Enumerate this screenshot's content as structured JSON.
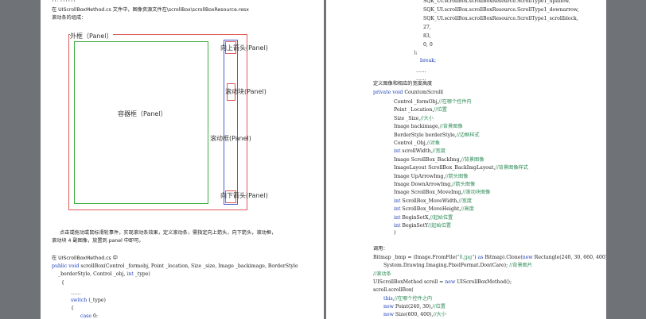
{
  "left_page": {
    "heading_fragment": "??. ??????",
    "intro_line": "在 UIScrollBoxMethod.cs 文件中，图像资源文件在\\scrollBox\\scrollBoxResource.resx",
    "intro_line2": "滚动条的组成：",
    "diagram": {
      "outer": "外框（Panel）",
      "up_arrow": "向上箭头(Panel)",
      "thumb": "滚动块(Panel)",
      "container": "容器框（Panel）",
      "track": "滚动框(Panel)",
      "down_arrow": "向下箭头(Panel)"
    },
    "paragraph1": "点击或拖动或鼠标滑轮事件，实现滚动条效果，定义滚动条，需指定向上箭头，向下箭头，滚动框，",
    "paragraph2": "滚动块 4 副图像，放置到 panel 中即可。",
    "code_intro": "在 UIScrollBoxMethod.cs 中",
    "code_lines": [
      {
        "kw": "public void",
        "text": " scrollBox(Control _formobj, Point _location, Size _size, Image _backimage, BorderStyle",
        "cm": ""
      },
      {
        "kw": "",
        "text": "_borderStyle, Control _obj, ",
        "kw2": "int",
        "text2": " _type)"
      },
      {
        "kw": "",
        "text": "{",
        "cm": ""
      },
      {
        "kw": "",
        "text": "……",
        "cm": ""
      },
      {
        "kw": "switch",
        "text": " (_type)",
        "cm": ""
      },
      {
        "kw": "",
        "text": "{",
        "cm": ""
      },
      {
        "kw": "case",
        "text": " 0:",
        "cm": ""
      }
    ]
  },
  "right_page": {
    "top_code": [
      "SQK_UI.scrollBox.scrollBoxResource.ScrollType1_upallow,",
      "SQK_UI.scrollBox.scrollBoxResource.ScrollType1_downarrow,",
      "SQK_UI.scrollBox.scrollBoxResource.ScrollType1_scrollblock,",
      "27,",
      "83,",
      "0, 0",
      ");",
      "break;",
      "……",
      "……"
    ],
    "section_title": "定义图像和相应的宽度高度",
    "ctor_kw": "private void",
    "ctor_name": " CountomScroll(",
    "params": [
      {
        "type": "Control",
        "name": " _formObj,",
        "cm": "//在哪个控件内",
        "kw": false
      },
      {
        "type": "Point",
        "name": " _Location,",
        "cm": "//位置",
        "kw": false
      },
      {
        "type": "Size",
        "name": " _Size,",
        "cm": "//大小",
        "kw": false
      },
      {
        "type": "Image",
        "name": " backimage,",
        "cm": "//背景图像",
        "kw": false
      },
      {
        "type": "BorderStyle",
        "name": " borderStyle,",
        "cm": "//边框样式",
        "kw": false
      },
      {
        "type": "Control",
        "name": " _Obj,",
        "cm": "//对象",
        "kw": false
      },
      {
        "type": "int",
        "name": " scrollWidth,",
        "cm": "//宽度",
        "kw": true
      },
      {
        "type": "Image",
        "name": " ScrollBox_BackImg,",
        "cm": "//背景图像",
        "kw": false
      },
      {
        "type": "ImageLayout",
        "name": " ScrollBox_BackImgLayout,",
        "cm": "//背景图像样式",
        "kw": false
      },
      {
        "type": "Image",
        "name": " UpArrowImg,",
        "cm": "//箭头图像",
        "kw": false
      },
      {
        "type": "Image",
        "name": " DownArrowImg,",
        "cm": "//箭头图像",
        "kw": false
      },
      {
        "type": "Image",
        "name": " ScrollBox_MoveImg,",
        "cm": "//滚动块图像",
        "kw": false
      },
      {
        "type": "int",
        "name": " ScrollBox_MoveWidth,",
        "cm": "//宽度",
        "kw": true
      },
      {
        "type": "int",
        "name": " ScrollBox_MoveHeight,",
        "cm": "//高度",
        "kw": true
      },
      {
        "type": "int",
        "name": " BeginSetX,",
        "cm": "//起始位置",
        "kw": true
      },
      {
        "type": "int",
        "name": " BeginSetY",
        "cm": "//起始位置",
        "kw": true
      }
    ],
    "close_paren": ")",
    "call_label": "调用：",
    "call_lines": [
      {
        "pre": "Bitmap _bmp = (Image.FromFile(",
        "str": "\"0.jpg\"",
        "mid": ") ",
        "kw": "as",
        "post": " Bitmap).Clone(",
        "kw2": "new",
        "post2": " Rectangle(240, 30, 660, 400),",
        "cm": ""
      },
      {
        "pre": "System.Drawing.Imaging.PixelFormat.DontCare); ",
        "str": "",
        "mid": "",
        "kw": "",
        "post": "",
        "kw2": "",
        "post2": "",
        "cm": "//背景图片"
      },
      {
        "pre": "",
        "str": "",
        "mid": "",
        "kw": "",
        "post": "",
        "kw2": "",
        "post2": "",
        "cm": "//滚动条"
      },
      {
        "pre": "UIScrollBoxMethod scroll = ",
        "str": "",
        "mid": "",
        "kw": "new",
        "post": " UIScrollBoxMethod();",
        "kw2": "",
        "post2": "",
        "cm": ""
      },
      {
        "pre": "scroll.scrollBox(",
        "str": "",
        "mid": "",
        "kw": "",
        "post": "",
        "kw2": "",
        "post2": "",
        "cm": ""
      },
      {
        "pre": "",
        "str": "",
        "mid": "",
        "kw": "this",
        "post": ",",
        "kw2": "",
        "post2": "",
        "cm": "//在哪个控件之内"
      },
      {
        "pre": "",
        "str": "",
        "mid": "",
        "kw": "new",
        "post": " Point(240, 30),",
        "kw2": "",
        "post2": "",
        "cm": "//位置"
      },
      {
        "pre": "",
        "str": "",
        "mid": "",
        "kw": "new",
        "post": " Size(600, 400),",
        "kw2": "",
        "post2": "",
        "cm": "//大小"
      }
    ]
  }
}
